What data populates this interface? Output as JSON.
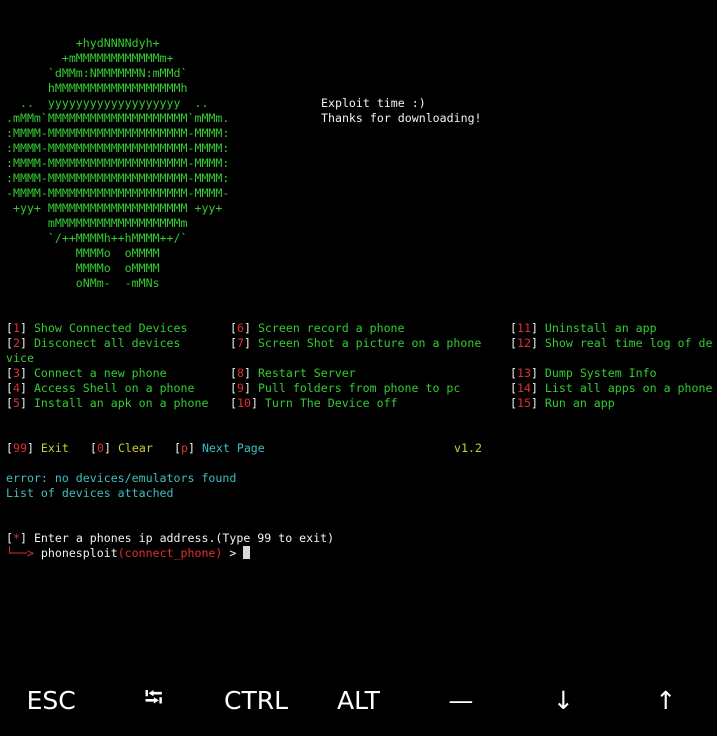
{
  "ascii_logo": [
    "          +hydNNNNdyh+",
    "        +mMMMMMMMMMMMMm+",
    "      `dMMm:NMMMMMMN:mMMd`",
    "      hMMMMMMMMMMMMMMMMMMh",
    "  ..  yyyyyyyyyyyyyyyyyyy  ..",
    ".mMMm`MMMMMMMMMMMMMMMMMMMM`mMMm.",
    ":MMMM-MMMMMMMMMMMMMMMMMMMM-MMMM:",
    ":MMMM-MMMMMMMMMMMMMMMMMMMM-MMMM:",
    ":MMMM-MMMMMMMMMMMMMMMMMMMM-MMMM:",
    ":MMMM-MMMMMMMMMMMMMMMMMMMM-MMMM:",
    "-MMMM-MMMMMMMMMMMMMMMMMMMM-MMMM-",
    " +yy+ MMMMMMMMMMMMMMMMMMMM +yy+",
    "      mMMMMMMMMMMMMMMMMMMm",
    "      `/++MMMMh++hMMMM++/`",
    "          MMMMo  oMMMM",
    "          MMMMo  oMMMM",
    "          oNMm-  -mMNs"
  ],
  "greeting": [
    "Exploit time :)",
    "Thanks for downloading!"
  ],
  "menu": {
    "col1": [
      {
        "num": "1",
        "label": "Show Connected Devices"
      },
      {
        "num": "2",
        "label": "Disconect all devices"
      },
      {
        "num": "3",
        "label": "Connect a new phone"
      },
      {
        "num": "4",
        "label": "Access Shell on a phone"
      },
      {
        "num": "5",
        "label": "Install an apk on a phone"
      }
    ],
    "col2": [
      {
        "num": "6",
        "label": "Screen record a phone"
      },
      {
        "num": "7",
        "label": "Screen Shot a picture on a phone"
      },
      {
        "num": "8",
        "label": "Restart Server"
      },
      {
        "num": "9",
        "label": "Pull folders from phone to pc"
      },
      {
        "num": "10",
        "label": "Turn The Device off"
      }
    ],
    "col3": [
      {
        "num": "11",
        "label": "Uninstall an app"
      },
      {
        "num": "12",
        "label": "Show real time log of de"
      },
      {
        "num": "13",
        "label": "Dump System Info"
      },
      {
        "num": "14",
        "label": "List all apps on a phone"
      },
      {
        "num": "15",
        "label": "Run an app"
      }
    ],
    "wrap_text": "vice"
  },
  "footer": {
    "exit_num": "99",
    "exit_label": "Exit",
    "clear_num": "0",
    "clear_label": "Clear",
    "next_num": "p",
    "next_label": "Next Page",
    "version": "v1.2"
  },
  "output": {
    "error": "error: no devices/emulators found",
    "list": "List of devices attached"
  },
  "prompt": {
    "marker": "*",
    "instruction": "Enter a phones ip address.(Type 99 to exit)",
    "arrow": "└──>",
    "app": "phonesploit",
    "context": "(connect_phone)",
    "symbol": ">"
  },
  "extra_keys": [
    "ESC",
    "⭾",
    "CTRL",
    "ALT",
    "—",
    "↓",
    "↑"
  ]
}
